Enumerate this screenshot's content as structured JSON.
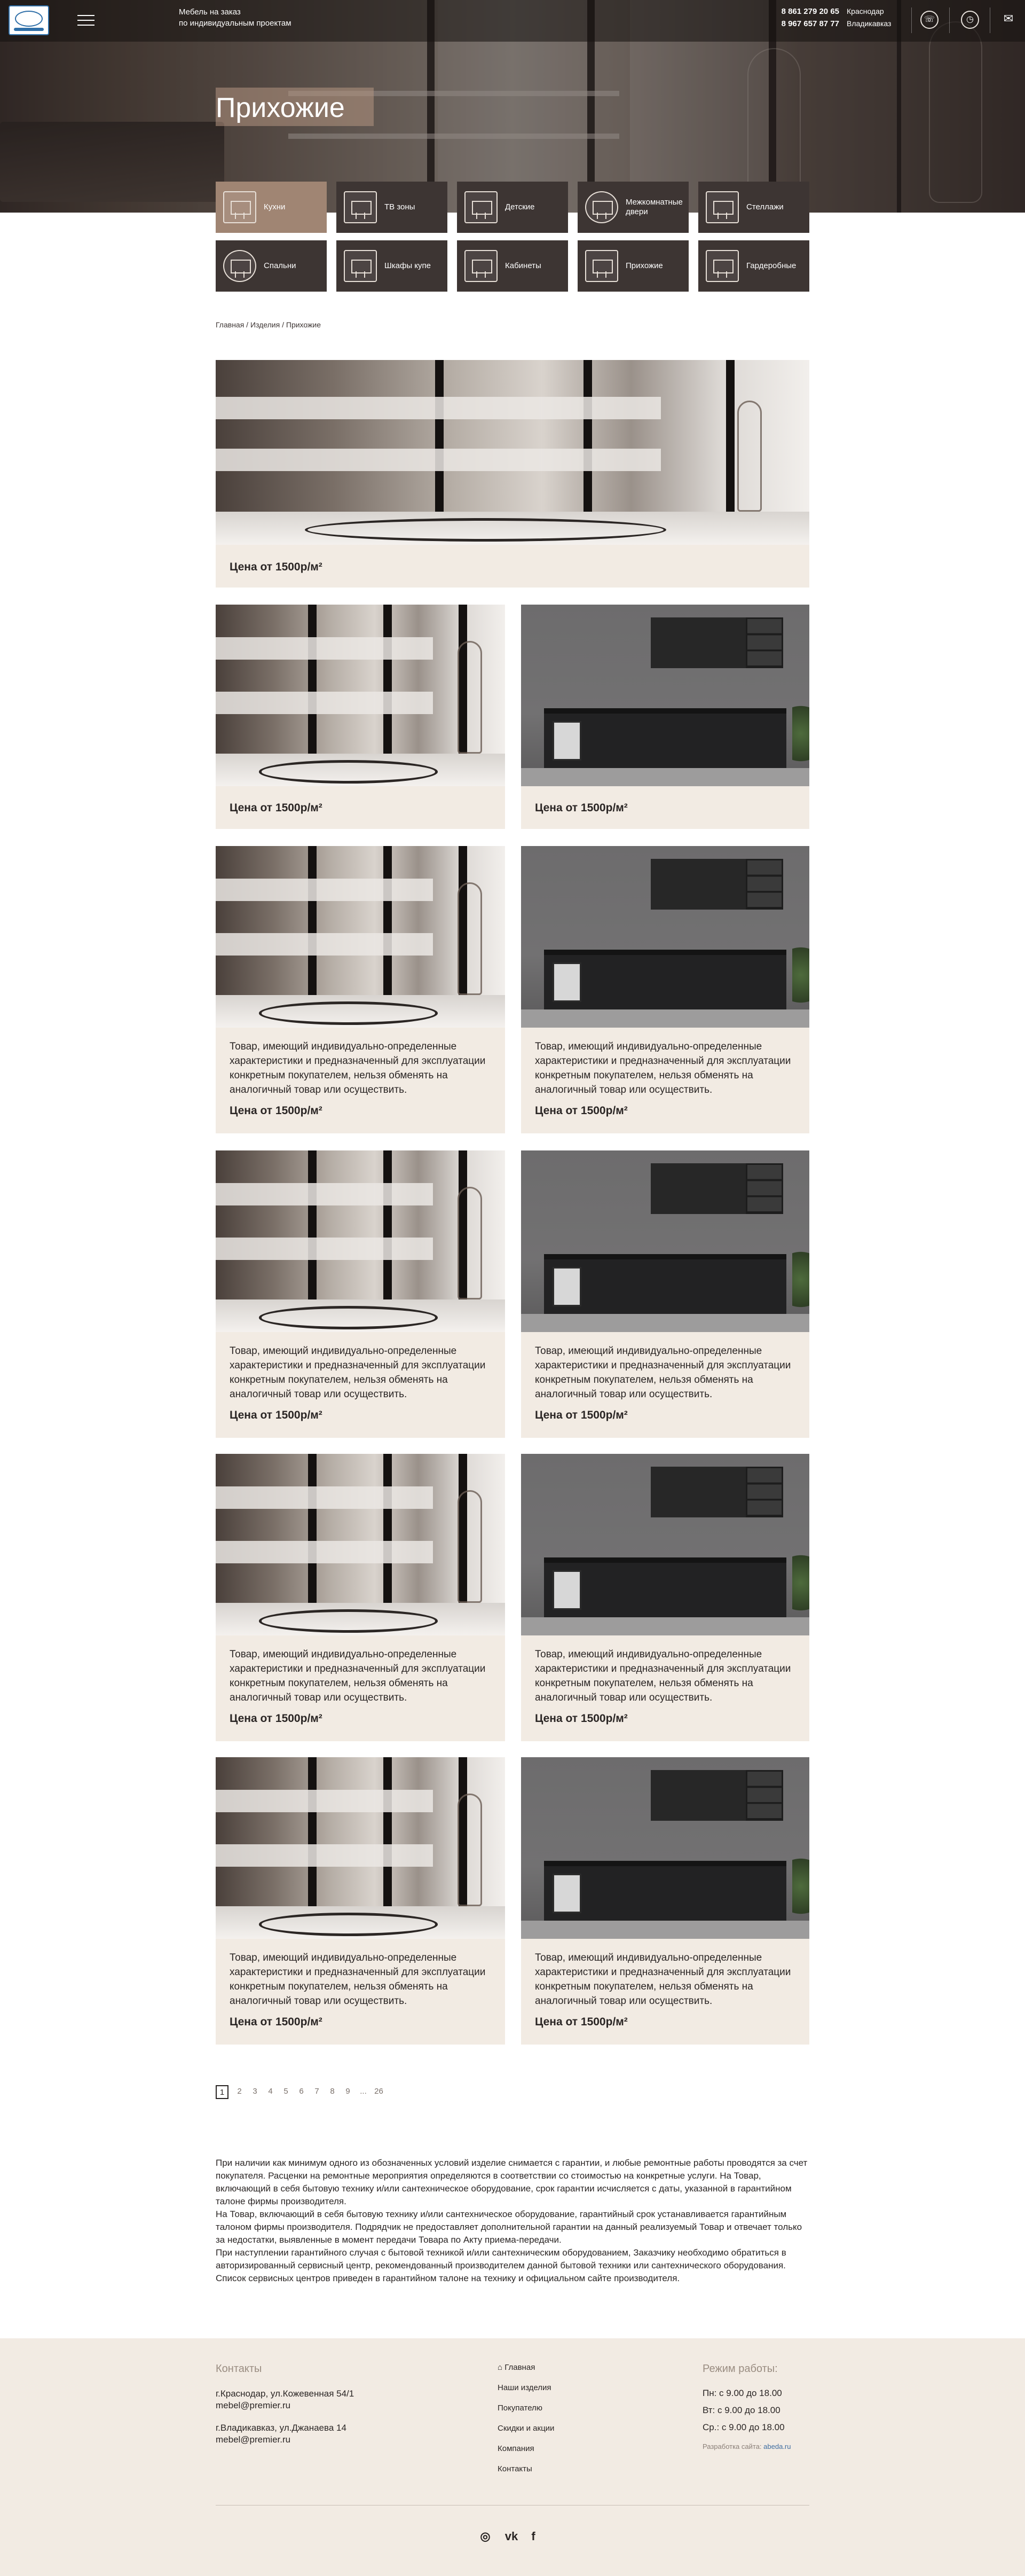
{
  "header": {
    "tagline_line1": "Мебель на заказ",
    "tagline_line2": "по индивидуальным проектам",
    "phones": [
      "8 861 279 20 65",
      "8 967 657 87 77"
    ],
    "cities": [
      "Краснодар",
      "Владикавказ"
    ],
    "icons": [
      "phone-icon",
      "clock-icon",
      "mail-icon"
    ],
    "logo_name": "logo"
  },
  "page_title": "Прихожие",
  "categories": [
    {
      "label": "Кухни",
      "icon": "kitchen-icon",
      "active": true
    },
    {
      "label": "ТВ зоны",
      "icon": "tv-zone-icon",
      "active": false
    },
    {
      "label": "Детские",
      "icon": "kids-room-icon",
      "active": false
    },
    {
      "label": "Межкомнатные двери",
      "icon": "door-icon",
      "active": false
    },
    {
      "label": "Стеллажи",
      "icon": "shelving-icon",
      "active": false
    },
    {
      "label": "Спальни",
      "icon": "bedroom-icon",
      "active": false
    },
    {
      "label": "Шкафы купе",
      "icon": "wardrobe-icon",
      "active": false
    },
    {
      "label": "Кабинеты",
      "icon": "office-icon",
      "active": false
    },
    {
      "label": "Прихожие",
      "icon": "hallway-icon",
      "active": false
    },
    {
      "label": "Гардеробные",
      "icon": "dressing-room-icon",
      "active": false
    }
  ],
  "breadcrumbs": [
    "Главная",
    "Изделия",
    "Прихожие"
  ],
  "breadcrumb_sep": " / ",
  "featured": {
    "price": "Цена от 1500р/м²"
  },
  "products": [
    {
      "image": "wardrobe",
      "description": "",
      "price": "Цена от 1500р/м²"
    },
    {
      "image": "kitchen",
      "description": "",
      "price": "Цена от 1500р/м²"
    },
    {
      "image": "wardrobe",
      "description": "Товар, имеющий индивидуально-определенные характеристики и предназначенный для эксплуатации конкретным покупателем, нельзя обменять на аналогичный товар или осуществить.",
      "price": "Цена от 1500р/м²"
    },
    {
      "image": "kitchen",
      "description": "Товар, имеющий индивидуально-определенные характеристики и предназначенный для эксплуатации конкретным покупателем, нельзя обменять на аналогичный товар или осуществить.",
      "price": "Цена от 1500р/м²"
    },
    {
      "image": "wardrobe",
      "description": "Товар, имеющий индивидуально-определенные характеристики и предназначенный для эксплуатации конкретным покупателем, нельзя обменять на аналогичный товар или осуществить.",
      "price": "Цена от 1500р/м²"
    },
    {
      "image": "kitchen",
      "description": "Товар, имеющий индивидуально-определенные характеристики и предназначенный для эксплуатации конкретным покупателем, нельзя обменять на аналогичный товар или осуществить.",
      "price": "Цена от 1500р/м²"
    },
    {
      "image": "wardrobe",
      "description": "Товар, имеющий индивидуально-определенные характеристики и предназначенный для эксплуатации конкретным покупателем, нельзя обменять на аналогичный товар или осуществить.",
      "price": "Цена от 1500р/м²"
    },
    {
      "image": "kitchen",
      "description": "Товар, имеющий индивидуально-определенные характеристики и предназначенный для эксплуатации конкретным покупателем, нельзя обменять на аналогичный товар или осуществить.",
      "price": "Цена от 1500р/м²"
    },
    {
      "image": "wardrobe",
      "description": "Товар, имеющий индивидуально-определенные характеристики и предназначенный для эксплуатации конкретным покупателем, нельзя обменять на аналогичный товар или осуществить.",
      "price": "Цена от 1500р/м²"
    },
    {
      "image": "kitchen",
      "description": "Товар, имеющий индивидуально-определенные характеристики и предназначенный для эксплуатации конкретным покупателем, нельзя обменять на аналогичный товар или осуществить.",
      "price": "Цена от 1500р/м²"
    }
  ],
  "pagination": {
    "current": "1",
    "pages": [
      "2",
      "3",
      "4",
      "5",
      "6",
      "7",
      "8",
      "9",
      "...",
      "26"
    ]
  },
  "policy_text": [
    "При наличии как минимум одного из обозначенных условий изделие снимается с гарантии, и любые ремонтные работы проводятся за счет покупателя. Расценки на ремонтные мероприятия определяются в соответствии со стоимостью на конкретные услуги. На Товар, включающий в себя бытовую технику и/или сантехническое оборудование, срок гарантии исчисляется с даты, указанной в гарантийном талоне фирмы производителя.",
    "На Товар, включающий в себя бытовую технику и/или сантехническое оборудование, гарантийный срок устанавливается гарантийным талоном фирмы производителя. Подрядчик не предоставляет дополнительной гарантии на данный реализуемый Товар и отвечает только за недостатки, выявленные в момент передачи Товара по Акту приема-передачи.",
    "При наступлении гарантийного случая с бытовой техникой и/или сантехническим оборудованием, Заказчику необходимо обратиться в авторизированный сервисный центр, рекомендованный производителем данной бытовой техники или сантехнического оборудования. Список сервисных центров приведен в гарантийном талоне на технику и официальном сайте производителя."
  ],
  "footer": {
    "contacts_title": "Контакты",
    "addresses": [
      {
        "address": "г.Краснодар, ул.Кожевенная 54/1",
        "email": "mebel@premier.ru"
      },
      {
        "address": "г.Владикавказ, ул.Джанаева 14",
        "email": "mebel@premier.ru"
      }
    ],
    "nav": [
      {
        "label": "Главная",
        "icon": "home-icon"
      },
      {
        "label": "Наши изделия"
      },
      {
        "label": "Покупателю"
      },
      {
        "label": "Скидки и акции"
      },
      {
        "label": "Компания"
      },
      {
        "label": "Контакты"
      }
    ],
    "hours_title": "Режим работы:",
    "hours": [
      "Пн: с 9.00 до 18.00",
      "Вт: с 9.00 до 18.00",
      "Ср.: с 9.00 до 18.00"
    ],
    "developer_label": "Разработка сайта:",
    "developer_name": "abeda.ru",
    "social_icons": [
      "instagram-icon",
      "vk-icon",
      "facebook-icon"
    ]
  }
}
